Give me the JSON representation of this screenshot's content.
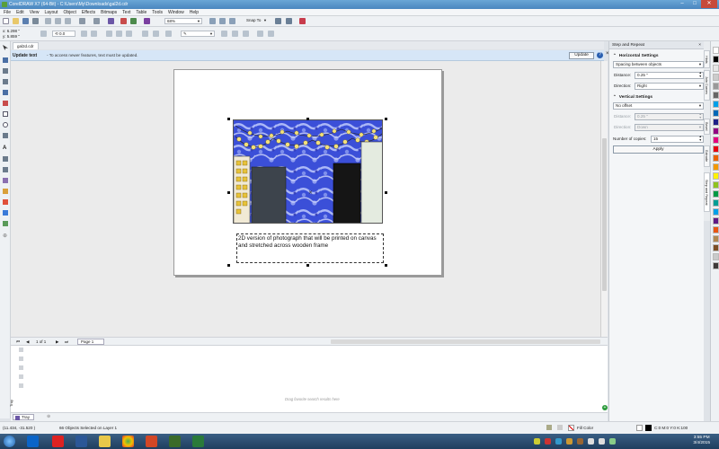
{
  "window": {
    "title": "CorelDRAW X7 (64-Bit) - C:\\Users\\My\\Downloads\\gal2d.cdr"
  },
  "menu": [
    "File",
    "Edit",
    "View",
    "Layout",
    "Object",
    "Effects",
    "Bitmaps",
    "Text",
    "Table",
    "Tools",
    "Window",
    "Help"
  ],
  "toolbar": {
    "zoom": "68%",
    "snap": "Snap To"
  },
  "propbar": {
    "x": "6.298 \"",
    "y": "5.859 \"",
    "angle": "0.0"
  },
  "doc_tab": "gal2d.cdr",
  "banner": {
    "title": "Update text",
    "message": "- To access newer features, text must be updated.",
    "button": "Update"
  },
  "textframe": {
    "text": "2D version of photograph that will be printed on canvas and stretched across wooden frame"
  },
  "pager": {
    "current": "1 of 1",
    "page_tab": "Page 1"
  },
  "tray": {
    "hint": "Drag favorite search results here",
    "tab": "Tray",
    "side_label": "Tray"
  },
  "status": {
    "coords": "(11.434, -31.520 )",
    "selection": "66 Objects Selected on Layer 1",
    "fill": "Fill Color",
    "outline": "C:0 M:0 Y:0 K:100"
  },
  "clock": {
    "time": "3:55 PM",
    "date": "3/4/2015"
  },
  "docker": {
    "title": "Step and Repeat",
    "horizontal": {
      "heading": "Horizontal Settings",
      "mode": "Spacing between objects",
      "distance_label": "Distance:",
      "distance": "0.25 \"",
      "direction_label": "Direction:",
      "direction": "Right"
    },
    "vertical": {
      "heading": "Vertical Settings",
      "mode": "No offset",
      "distance_label": "Distance:",
      "distance": "0.25 \"",
      "direction_label": "Direction:",
      "direction": "Down"
    },
    "copies_label": "Number of copies:",
    "copies": "15",
    "apply": "Apply"
  },
  "docker_tabs": [
    "Hints",
    "Join Curves",
    "Bevel",
    "Extrude",
    "Step and Repeat"
  ],
  "palette": [
    "#ffffff",
    "#000000",
    "#e6e6e6",
    "#cccccc",
    "#999999",
    "#666666",
    "#00a0e9",
    "#0068b7",
    "#1d2088",
    "#920783",
    "#e4007f",
    "#e60012",
    "#eb6100",
    "#f39800",
    "#fff100",
    "#8fc31f",
    "#009944",
    "#009e96",
    "#00a0e9",
    "#601986",
    "#e95513",
    "#b28850",
    "#7d4e24",
    "#c9caca",
    "#3e3a39"
  ]
}
